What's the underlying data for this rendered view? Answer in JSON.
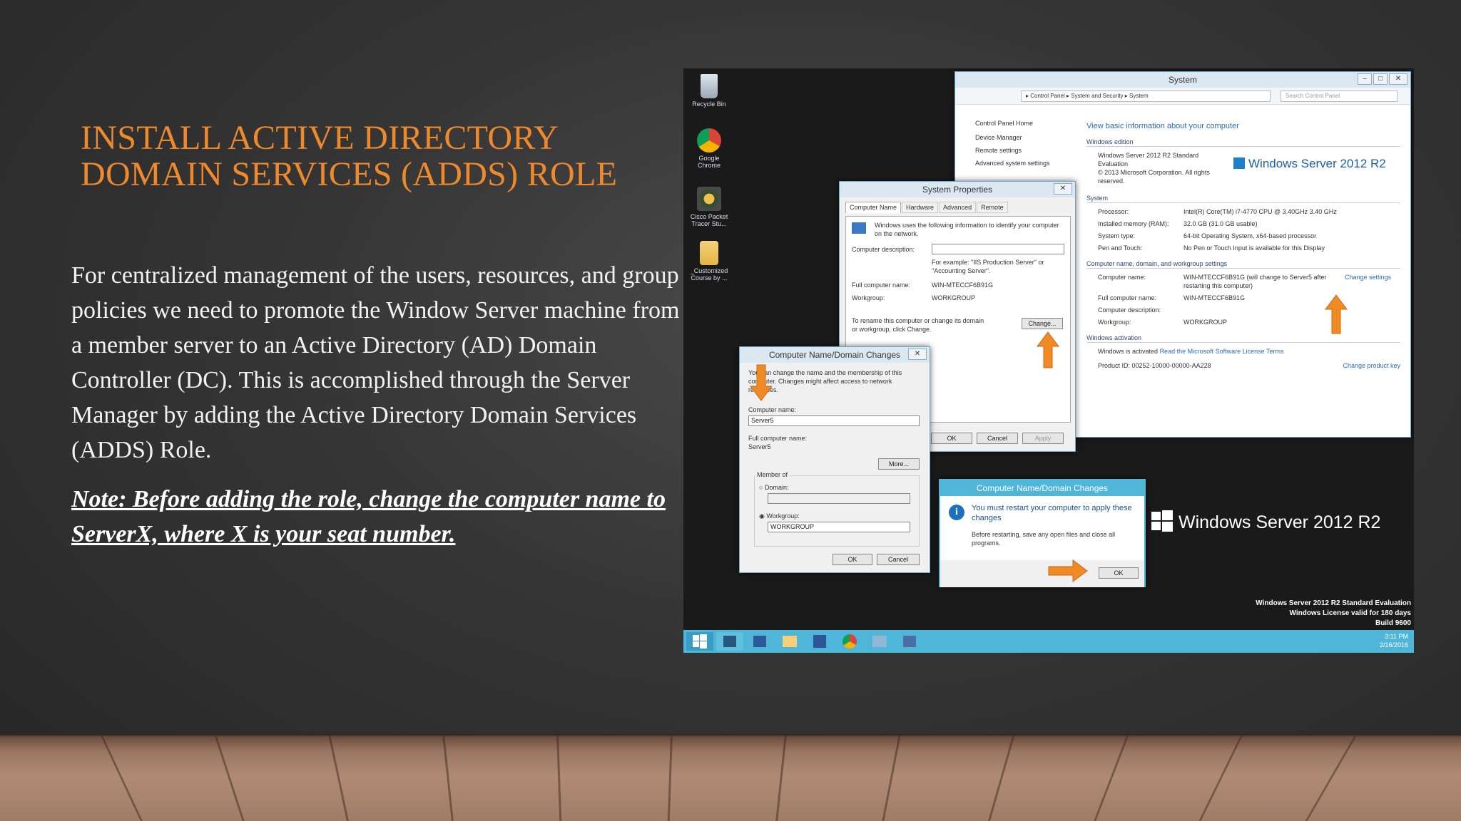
{
  "slide": {
    "title_line1": "Install Active Directory",
    "title_line2": "Domain Services (ADDS) Role",
    "body": "For centralized management of the users, resources, and group policies we need to promote the Window Server machine from a member server to an Active Directory (AD) Domain Controller (DC).  This is accomplished through the Server Manager by adding the Active Directory Domain Services (ADDS) Role.",
    "note": "Note: Before adding the role, change the computer name to ServerX, where X is your seat number."
  },
  "colors": {
    "accent": "#ee8a2c",
    "taskbar": "#4fb6da",
    "link": "#2a6bb8"
  },
  "desktop": {
    "icons": [
      {
        "label": "Recycle Bin",
        "icon": "recycle-bin-icon"
      },
      {
        "label": "Google Chrome",
        "icon": "chrome-icon"
      },
      {
        "label": "Cisco Packet Tracer Stu...",
        "icon": "packet-tracer-icon"
      },
      {
        "label": "_Customized Course by ...",
        "icon": "folder-icon"
      }
    ],
    "watermark": [
      "Windows Server 2012 R2 Standard Evaluation",
      "Windows License valid for 180 days",
      "Build 9600"
    ],
    "logo_text": "Windows Server 2012 R2"
  },
  "system_window": {
    "title": "System",
    "breadcrumb": "▸ Control Panel ▸ System and Security ▸ System",
    "search_placeholder": "Search Control Panel",
    "side_links": [
      "Control Panel Home",
      "Device Manager",
      "Remote settings",
      "Advanced system settings"
    ],
    "heading": "View basic information about your computer",
    "edition_header": "Windows edition",
    "edition_name": "Windows Server 2012 R2 Standard Evaluation",
    "copyright": "© 2013 Microsoft Corporation. All rights reserved.",
    "logo": "Windows Server 2012 R2",
    "system_header": "System",
    "system_rows": [
      {
        "label": "Processor:",
        "value": "Intel(R) Core(TM) i7-4770 CPU @ 3.40GHz   3.40 GHz"
      },
      {
        "label": "Installed memory (RAM):",
        "value": "32.0 GB (31.0 GB usable)"
      },
      {
        "label": "System type:",
        "value": "64-bit Operating System, x64-based processor"
      },
      {
        "label": "Pen and Touch:",
        "value": "No Pen or Touch Input is available for this Display"
      }
    ],
    "name_header": "Computer name, domain, and workgroup settings",
    "name_rows": [
      {
        "label": "Computer name:",
        "value": "WIN-MTECCF6B91G (will change to Server5 after restarting this computer)"
      },
      {
        "label": "Full computer name:",
        "value": "WIN-MTECCF6B91G"
      },
      {
        "label": "Computer description:",
        "value": ""
      },
      {
        "label": "Workgroup:",
        "value": "WORKGROUP"
      }
    ],
    "change_settings": "Change settings",
    "activation_header": "Windows activation",
    "activation_status": "Windows is activated",
    "license_link": "Read the Microsoft Software License Terms",
    "product_id": "Product ID: 00252-10000-00000-AA228",
    "change_key": "Change product key"
  },
  "sysprops": {
    "title": "System Properties",
    "tabs": [
      "Computer Name",
      "Hardware",
      "Advanced",
      "Remote"
    ],
    "intro": "Windows uses the following information to identify your computer on the network.",
    "desc_label": "Computer description:",
    "example": "For example: \"IIS Production Server\" or \"Accounting Server\".",
    "full_label": "Full computer name:",
    "full_value": "WIN-MTECCF6B91G",
    "wg_label": "Workgroup:",
    "wg_value": "WORKGROUP",
    "rename_text": "To rename this computer or change its domain or workgroup, click Change.",
    "change_btn": "Change...",
    "ok": "OK",
    "cancel": "Cancel",
    "apply": "Apply"
  },
  "namechange": {
    "title": "Computer Name/Domain Changes",
    "intro": "You can change the name and the membership of this computer. Changes might affect access to network resources.",
    "name_label": "Computer name:",
    "name_value": "Server5",
    "full_label": "Full computer name:",
    "full_value": "Server5",
    "more_btn": "More...",
    "member_label": "Member of",
    "domain_label": "Domain:",
    "workgroup_label": "Workgroup:",
    "workgroup_value": "WORKGROUP",
    "ok": "OK",
    "cancel": "Cancel"
  },
  "restart": {
    "title": "Computer Name/Domain Changes",
    "message": "You must restart your computer to apply these changes",
    "detail": "Before restarting, save any open files and close all programs.",
    "ok": "OK"
  },
  "taskbar": {
    "clock_time": "3:11 PM",
    "clock_date": "2/16/2016",
    "items": [
      "start-icon",
      "server-manager-icon",
      "powershell-icon",
      "explorer-icon",
      "word-icon",
      "chrome-icon",
      "network-icon",
      "app-icon"
    ]
  }
}
